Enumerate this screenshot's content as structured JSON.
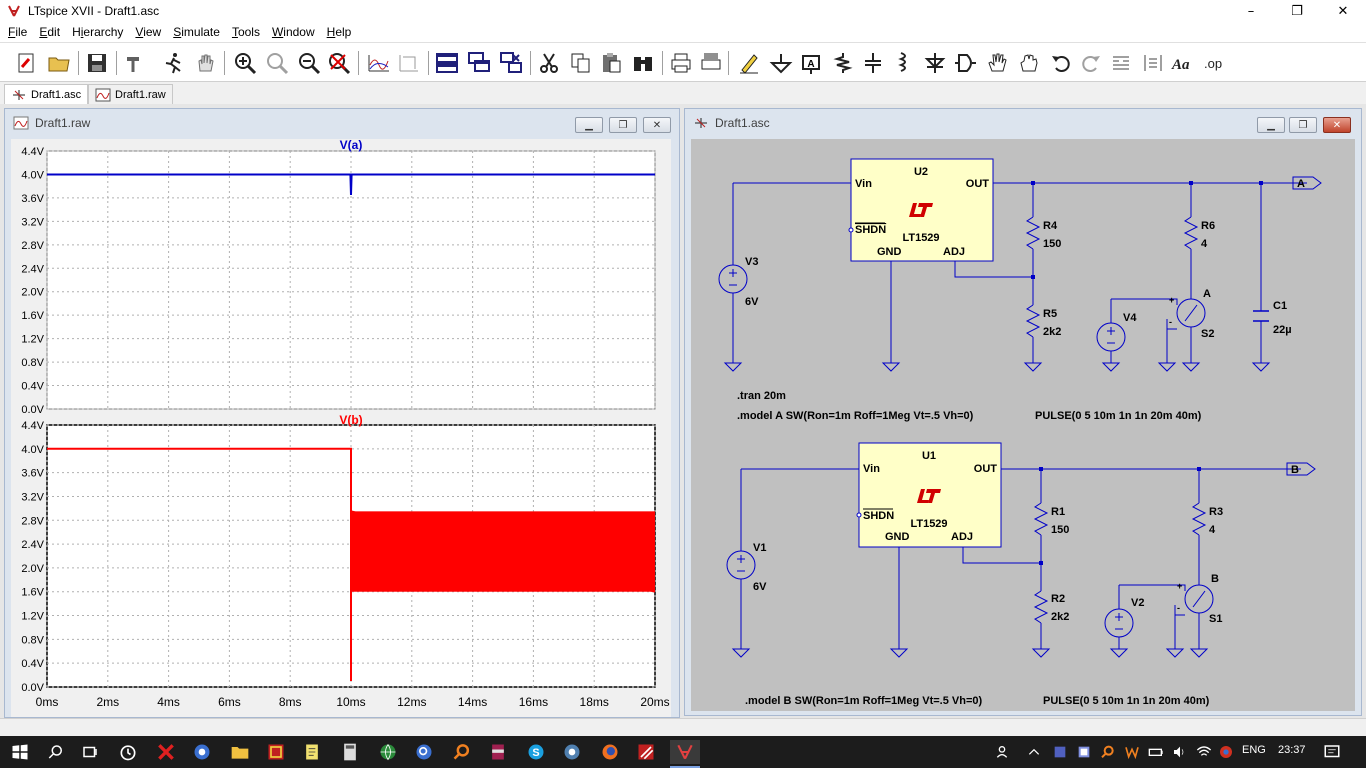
{
  "window": {
    "title": "LTspice XVII - Draft1.asc",
    "minimize": "–",
    "maximize": "❐",
    "close": "✕"
  },
  "menu": [
    {
      "pre": "",
      "ul": "F",
      "post": "ile"
    },
    {
      "pre": "",
      "ul": "E",
      "post": "dit"
    },
    {
      "pre": "H",
      "ul": "i",
      "post": "erarchy"
    },
    {
      "pre": "",
      "ul": "V",
      "post": "iew"
    },
    {
      "pre": "",
      "ul": "S",
      "post": "imulate"
    },
    {
      "pre": "",
      "ul": "T",
      "post": "ools"
    },
    {
      "pre": "",
      "ul": "W",
      "post": "indow"
    },
    {
      "pre": "",
      "ul": "H",
      "post": "elp"
    }
  ],
  "toolbar": {
    "spice_directive": ".op",
    "text_tool": "Aa"
  },
  "tabs": [
    {
      "label": "Draft1.asc"
    },
    {
      "label": "Draft1.raw"
    }
  ],
  "waveform_window": {
    "title": "Draft1.raw",
    "top_pane": {
      "trace": "V(a)",
      "color": "#0000c8",
      "y_ticks": [
        "4.4V",
        "4.0V",
        "3.6V",
        "3.2V",
        "2.8V",
        "2.4V",
        "2.0V",
        "1.6V",
        "1.2V",
        "0.8V",
        "0.4V",
        "0.0V"
      ]
    },
    "bottom_pane": {
      "trace": "V(b)",
      "color": "#ff0000",
      "y_ticks": [
        "4.4V",
        "4.0V",
        "3.6V",
        "3.2V",
        "2.8V",
        "2.4V",
        "2.0V",
        "1.6V",
        "1.2V",
        "0.8V",
        "0.4V",
        "0.0V"
      ]
    },
    "x_ticks": [
      "0ms",
      "2ms",
      "4ms",
      "6ms",
      "8ms",
      "10ms",
      "12ms",
      "14ms",
      "16ms",
      "18ms",
      "20ms"
    ]
  },
  "chart_data": [
    {
      "type": "line",
      "title": "V(a)",
      "x_unit": "ms",
      "xlim": [
        0,
        20
      ],
      "ylim": [
        0,
        4.4
      ],
      "series": [
        {
          "name": "V(a)",
          "x": [
            0,
            9.98,
            10.0,
            10.02,
            20
          ],
          "y": [
            4.0,
            4.0,
            3.65,
            4.0,
            4.0
          ]
        }
      ]
    },
    {
      "type": "line",
      "title": "V(b)",
      "x_unit": "ms",
      "xlim": [
        0,
        20
      ],
      "ylim": [
        0,
        4.4
      ],
      "series": [
        {
          "name": "V(b)",
          "x": [
            0,
            10.0,
            10.0,
            10.0,
            20
          ],
          "y": [
            4.0,
            4.0,
            0.1,
            2.95,
            1.6
          ]
        }
      ],
      "oscillation_band": {
        "x_start": 10.0,
        "x_end": 20,
        "y_low": 1.6,
        "y_high": 2.95
      }
    }
  ],
  "schematic_window": {
    "title": "Draft1.asc",
    "top_circuit": {
      "ic_name": "U2",
      "ic_part": "LT1529",
      "pins": {
        "vin": "Vin",
        "out": "OUT",
        "shdn": "SHDN",
        "gnd": "GND",
        "adj": "ADJ"
      },
      "r_top": {
        "name": "R4",
        "value": "150"
      },
      "r_bottom": {
        "name": "R5",
        "value": "2k2"
      },
      "r_load": {
        "name": "R6",
        "value": "4"
      },
      "cap": {
        "name": "C1",
        "value": "22µ"
      },
      "vsrc": {
        "name": "V3",
        "value": "6V"
      },
      "ctrl_src": {
        "name": "V4"
      },
      "switch": {
        "name": "S2",
        "model": "A"
      },
      "label": "A",
      "directive1": ".tran 20m",
      "directive2": ".model A SW(Ron=1m Roff=1Meg Vt=.5 Vh=0)",
      "pulse": "PULSE(0 5 10m 1n 1n 20m 40m)"
    },
    "bottom_circuit": {
      "ic_name": "U1",
      "ic_part": "LT1529",
      "pins": {
        "vin": "Vin",
        "out": "OUT",
        "shdn": "SHDN",
        "gnd": "GND",
        "adj": "ADJ"
      },
      "r_top": {
        "name": "R1",
        "value": "150"
      },
      "r_bottom": {
        "name": "R2",
        "value": "2k2"
      },
      "r_load": {
        "name": "R3",
        "value": "4"
      },
      "vsrc": {
        "name": "V1",
        "value": "6V"
      },
      "ctrl_src": {
        "name": "V2"
      },
      "switch": {
        "name": "S1",
        "model": "B"
      },
      "label": "B",
      "directive2": ".model B SW(Ron=1m Roff=1Meg Vt=.5 Vh=0)",
      "pulse": "PULSE(0 5 10m 1n 1n 20m 40m)"
    }
  },
  "taskbar": {
    "language": "ENG",
    "time": "23:37"
  },
  "colors": {
    "schematic_bg": "#c0c0c0",
    "wire": "#0000c8",
    "ic_fill": "#ffffc8",
    "lt_logo": "#d00000"
  }
}
